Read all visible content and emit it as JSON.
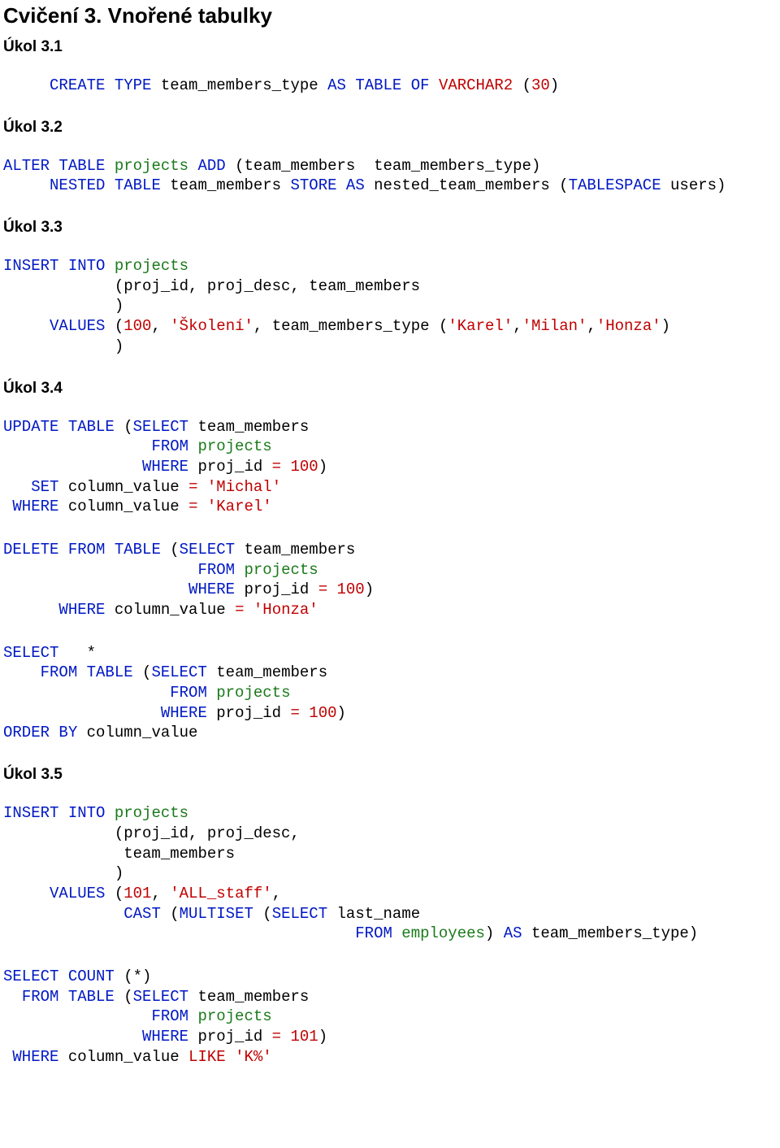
{
  "title_prefix": "Cvičení 3.",
  "title_rest": "Vnořené tabulky",
  "h_3_1": "Úkol 3.1",
  "h_3_2": "Úkol 3.2",
  "h_3_3": "Úkol 3.3",
  "h_3_4": "Úkol 3.4",
  "h_3_5": "Úkol 3.5",
  "c31_1": "CREATE",
  "c31_2": "TYPE",
  "c31_3": " team_members_type ",
  "c31_4": "AS",
  "c31_5": "TABLE",
  "c31_6": "OF",
  "c31_7": "VARCHAR2",
  "c31_8": "(",
  "c31_9": "30",
  "c31_10": ")",
  "c32_1": "ALTER",
  "c32_2": "TABLE",
  "c32_3": "projects",
  "c32_4": "ADD",
  "c32_5": " (team_members  team_members_type)",
  "c32_6": "NESTED",
  "c32_7": "TABLE",
  "c32_8": " team_members ",
  "c32_9": "STORE",
  "c32_10": "AS",
  "c32_11": " nested_team_members (",
  "c32_12": "TABLESPACE",
  "c32_13": " users)",
  "c33_1": "INSERT",
  "c33_2": "INTO",
  "c33_3": "projects",
  "c33_4": "            (proj_id, proj_desc, team_members",
  "c33_5": "            )",
  "c33_6": "VALUES",
  "c33_7": " (",
  "c33_8": "100",
  "c33_9": ", ",
  "c33_10": "'Školení'",
  "c33_11": ", team_members_type (",
  "c33_12": "'Karel'",
  "c33_13": ",",
  "c33_14": "'Milan'",
  "c33_15": ",",
  "c33_16": "'Honza'",
  "c33_17": ")",
  "c33_18": "            )",
  "c34a_1": "UPDATE",
  "c34a_2": "TABLE",
  "c34a_3": " (",
  "c34a_4": "SELECT",
  "c34a_5": " team_members",
  "c34a_6": "FROM",
  "c34a_7": "projects",
  "c34a_8": "WHERE",
  "c34a_9": " proj_id ",
  "c34a_10": "=",
  "c34a_11": "100",
  "c34a_12": ")",
  "c34a_13": "SET",
  "c34a_14": " column_value ",
  "c34a_15": "=",
  "c34a_16": "'Michal'",
  "c34a_17": "WHERE",
  "c34a_18": " column_value ",
  "c34a_19": "=",
  "c34a_20": "'Karel'",
  "c34b_1": "DELETE",
  "c34b_2": "FROM",
  "c34b_3": "TABLE",
  "c34b_4": " (",
  "c34b_5": "SELECT",
  "c34b_6": " team_members",
  "c34b_7": "FROM",
  "c34b_8": "projects",
  "c34b_9": "WHERE",
  "c34b_10": " proj_id ",
  "c34b_11": "=",
  "c34b_12": "100",
  "c34b_13": ")",
  "c34b_14": "WHERE",
  "c34b_15": " column_value ",
  "c34b_16": "=",
  "c34b_17": "'Honza'",
  "c34c_1": "SELECT",
  "c34c_2": "   *",
  "c34c_3": "FROM",
  "c34c_4": "TABLE",
  "c34c_5": " (",
  "c34c_6": "SELECT",
  "c34c_7": " team_members",
  "c34c_8": "FROM",
  "c34c_9": "projects",
  "c34c_10": "WHERE",
  "c34c_11": " proj_id ",
  "c34c_12": "=",
  "c34c_13": "100",
  "c34c_14": ")",
  "c34c_15": "ORDER",
  "c34c_16": "BY",
  "c34c_17": " column_value",
  "c35a_1": "INSERT",
  "c35a_2": "INTO",
  "c35a_3": "projects",
  "c35a_4": "            (proj_id, proj_desc,",
  "c35a_5": "             team_members",
  "c35a_6": "            )",
  "c35a_7": "VALUES",
  "c35a_8": " (",
  "c35a_9": "101",
  "c35a_10": ", ",
  "c35a_11": "'ALL_staff'",
  "c35a_12": ",",
  "c35a_13": "CAST",
  "c35a_14": " (",
  "c35a_15": "MULTISET",
  "c35a_16": " (",
  "c35a_17": "SELECT",
  "c35a_18": " last_name",
  "c35a_19": "FROM",
  "c35a_20": "employees",
  "c35a_21": ") ",
  "c35a_22": "AS",
  "c35a_23": " team_members_type)",
  "c35b_1": "SELECT",
  "c35b_2": "COUNT",
  "c35b_3": " (*)",
  "c35b_4": "FROM",
  "c35b_5": "TABLE",
  "c35b_6": " (",
  "c35b_7": "SELECT",
  "c35b_8": " team_members",
  "c35b_9": "FROM",
  "c35b_10": "projects",
  "c35b_11": "WHERE",
  "c35b_12": " proj_id ",
  "c35b_13": "=",
  "c35b_14": "101",
  "c35b_15": ")",
  "c35b_16": "WHERE",
  "c35b_17": " column_value ",
  "c35b_18": "LIKE",
  "c35b_19": "'K%'"
}
